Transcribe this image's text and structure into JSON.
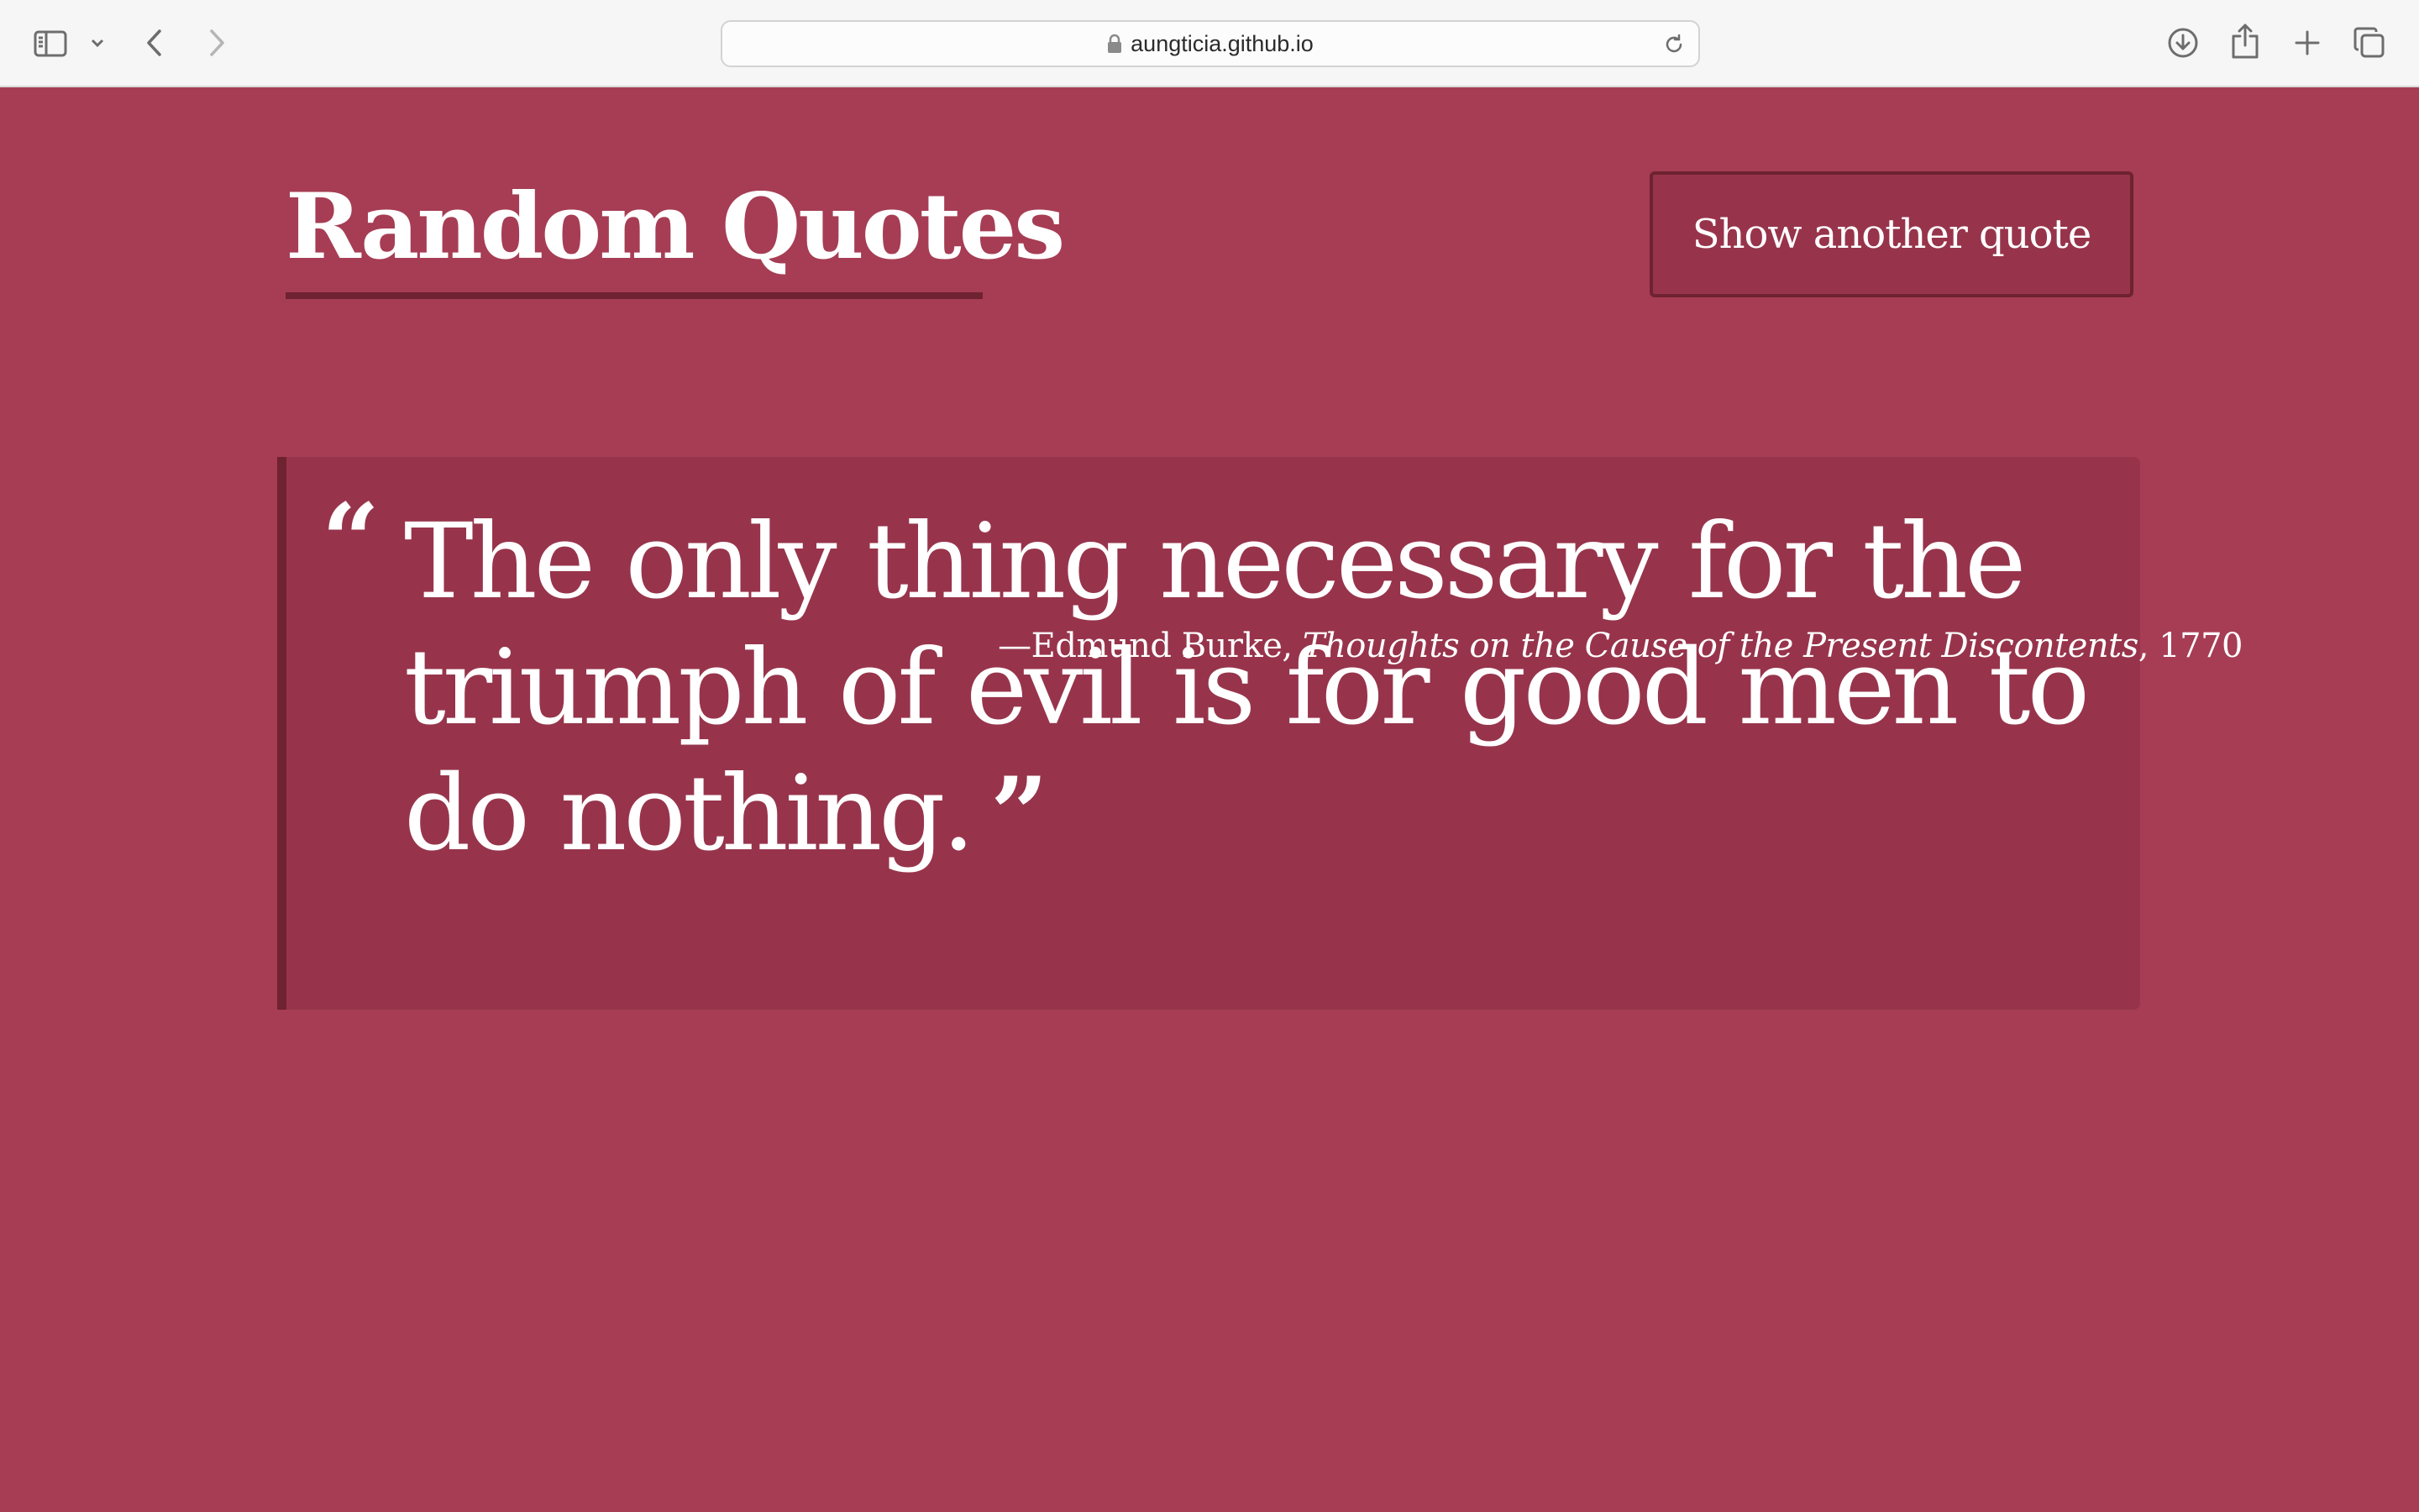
{
  "browser": {
    "url": "aungticia.github.io",
    "icons": {
      "sidebar": "sidebar-icon",
      "chevron": "chevron-down-icon",
      "back": "back-arrow-icon",
      "forward": "forward-arrow-icon",
      "lock": "lock-icon",
      "reload": "reload-icon",
      "download": "download-icon",
      "share": "share-icon",
      "new_tab": "plus-icon",
      "tab_overview": "tab-overview-icon"
    }
  },
  "page": {
    "title": "Random Quotes",
    "button_label": "Show another quote",
    "colors": {
      "background": "#a63d54",
      "panel": "#97344b",
      "accent_dark": "#6e2232",
      "text": "#ffffff"
    }
  },
  "quote": {
    "open_mark": "“",
    "text": "The only thing necessary for the triumph of evil is for good men to do nothing.",
    "close_mark": "”",
    "author_prefix": "—Edmund Burke, ",
    "work": "Thoughts on the Cause of the Present Discontents",
    "year_suffix": ", 1770"
  }
}
